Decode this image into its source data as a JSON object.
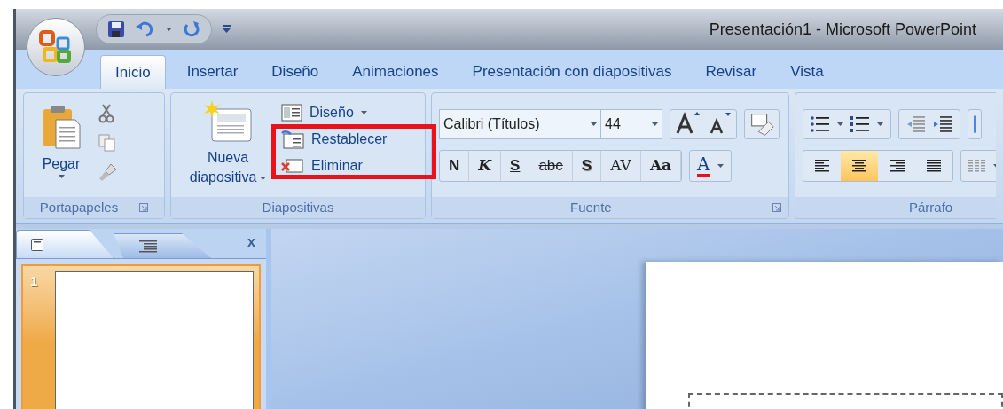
{
  "window": {
    "title": "Presentación1 - Microsoft PowerPoint"
  },
  "tabs": [
    {
      "label": "Inicio",
      "selected": true
    },
    {
      "label": "Insertar",
      "selected": false
    },
    {
      "label": "Diseño",
      "selected": false
    },
    {
      "label": "Animaciones",
      "selected": false
    },
    {
      "label": "Presentación con diapositivas",
      "selected": false
    },
    {
      "label": "Revisar",
      "selected": false
    },
    {
      "label": "Vista",
      "selected": false
    }
  ],
  "clipboard": {
    "label": "Portapapeles",
    "paste": "Pegar"
  },
  "slides_group": {
    "label": "Diapositivas",
    "new_slide": "Nueva diapositiva",
    "layout": "Diseño",
    "reset": "Restablecer",
    "delete": "Eliminar"
  },
  "font": {
    "label": "Fuente",
    "name": "Calibri (Títulos)",
    "size": "44",
    "buttons": [
      {
        "kind": "bold",
        "text": "N"
      },
      {
        "kind": "italic",
        "text": "K"
      },
      {
        "kind": "underline",
        "text": "S"
      },
      {
        "kind": "strike",
        "text": "abc"
      },
      {
        "kind": "shadow",
        "text": "S"
      },
      {
        "kind": "spacing",
        "text": "AV"
      },
      {
        "kind": "case",
        "text": "Aa"
      }
    ],
    "color_text": "A"
  },
  "paragraph": {
    "label": "Párrafo",
    "alignments": [
      {
        "kind": "left",
        "selected": false
      },
      {
        "kind": "center",
        "selected": true
      },
      {
        "kind": "right",
        "selected": false
      },
      {
        "kind": "justify",
        "selected": false
      }
    ]
  },
  "slide_pane": {
    "tabs": [
      {
        "kind": "slides",
        "selected": true
      },
      {
        "kind": "outline",
        "selected": false
      }
    ],
    "close": "x",
    "thumbnails": [
      {
        "number": "1",
        "selected": true
      }
    ]
  }
}
